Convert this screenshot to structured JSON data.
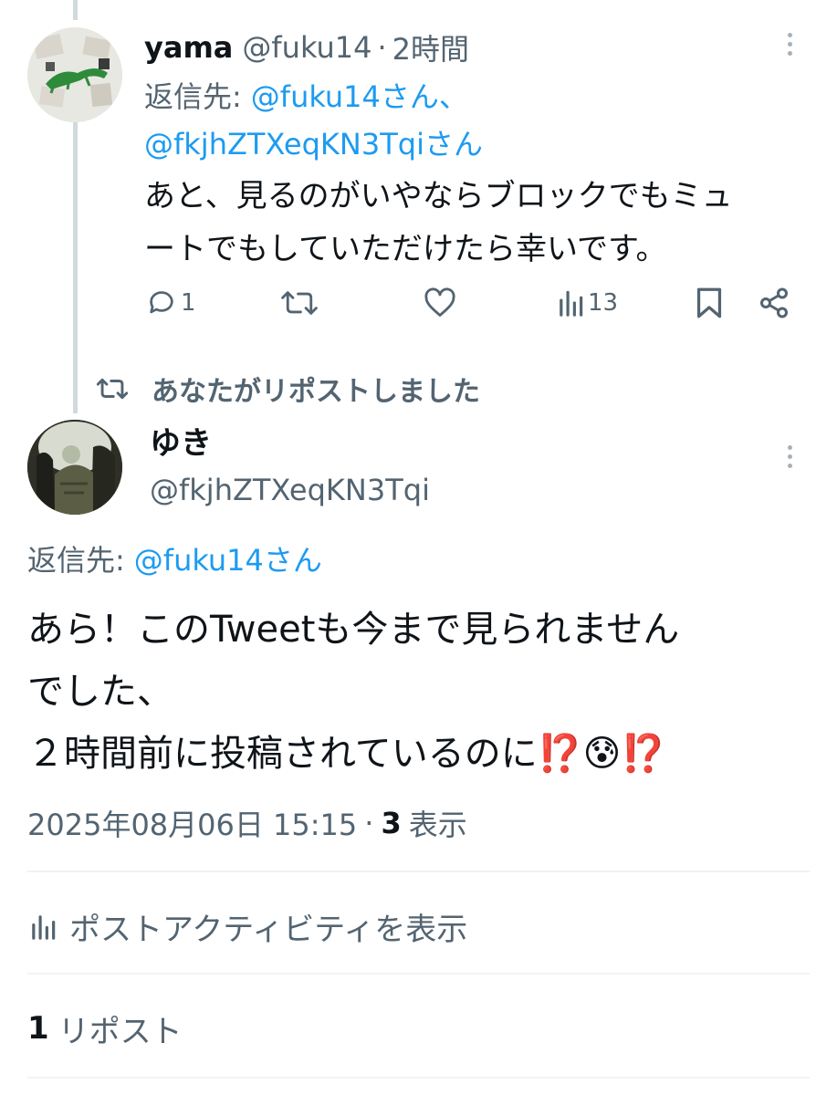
{
  "reply_tweet": {
    "display_name": "yama",
    "handle": "@fuku14",
    "separator": "·",
    "time": "2時間",
    "reply_label": "返信先:",
    "reply_to_1": "@fuku14さん、",
    "reply_to_2": "@fkjhZTXeqKN3Tqiさん",
    "text_line1": "あと、見るのがいやならブロックでもミュ",
    "text_line2": "ートでもしていただけたら幸いです。",
    "reply_count": "1",
    "views_count": "13"
  },
  "repost_banner": {
    "text": "あなたがリポストしました"
  },
  "main_tweet": {
    "display_name": "ゆき",
    "handle": "@fkjhZTXeqKN3Tqi",
    "reply_label": "返信先:",
    "reply_to": "@fuku14さん",
    "text_line1": "あら！このTweetも今まで見られません",
    "text_line2": "でした、",
    "text_line3": "２時間前に投稿されているのに",
    "emoji_1": "⁉️",
    "emoji_2": "😰",
    "emoji_3": "⁉️",
    "timestamp": "2025年08月06日 15:15",
    "separator": "·",
    "views_number": "3",
    "views_label": "表示",
    "activity_label": "ポストアクティビティを表示",
    "repost_count": "1",
    "repost_label": "リポスト"
  },
  "colors": {
    "accent": "#1d9bf0",
    "muted": "#536471",
    "thread_line": "#cfd9de",
    "divider": "#eff3f4"
  }
}
